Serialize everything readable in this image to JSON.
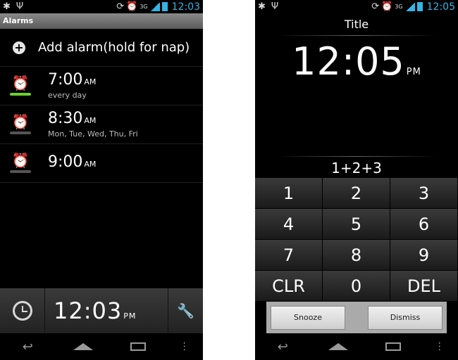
{
  "left": {
    "status_time": "12:03",
    "title": "Alarms",
    "add_label": "Add alarm(hold for nap)",
    "alarms": [
      {
        "time": "7:00",
        "ampm": "AM",
        "days": "every day",
        "enabled": true
      },
      {
        "time": "8:30",
        "ampm": "AM",
        "days": "Mon, Tue, Wed, Thu, Fri",
        "enabled": false
      },
      {
        "time": "9:00",
        "ampm": "AM",
        "days": "",
        "enabled": false
      }
    ],
    "clock_time": "12:03",
    "clock_ampm": "PM"
  },
  "right": {
    "status_time": "12:05",
    "title": "Title",
    "clock_time": "12:05",
    "clock_ampm": "PM",
    "question": "1+2+3",
    "keys": [
      "1",
      "2",
      "3",
      "4",
      "5",
      "6",
      "7",
      "8",
      "9",
      "CLR",
      "0",
      "DEL"
    ],
    "snooze_label": "Snooze",
    "dismiss_label": "Dismiss"
  },
  "status": {
    "network_label": "3G"
  },
  "colors": {
    "accent": "#33b5e5",
    "enabled_indicator": "#6ccf2e",
    "disabled_indicator": "#555555"
  },
  "icons": {
    "add": "plus-circle-icon",
    "alarm": "alarm-clock-icon",
    "clock": "clock-icon",
    "settings": "wrench-icon"
  }
}
